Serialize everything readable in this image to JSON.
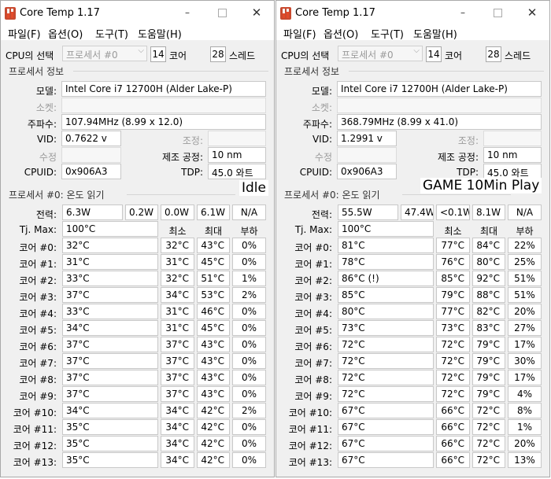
{
  "windows": [
    {
      "title": "Core Temp 1.17",
      "menu": [
        "파일(F)",
        "옵션(O)",
        "도구(T)",
        "도움말(H)"
      ],
      "cpu_select_label": "CPU의 선택",
      "processor_select": "프로세서 #0",
      "cores_count": "14",
      "cores_label": "코어",
      "threads_count": "28",
      "threads_label": "스레드",
      "info_group": "프로세서 정보",
      "model_label": "모델:",
      "model": "Intel Core i7 12700H (Alder Lake-P)",
      "socket_label": "소켓:",
      "frequency_label": "주파수:",
      "frequency": "107.94MHz (8.99 x 12.0)",
      "vid_label": "VID:",
      "vid": "0.7622 v",
      "modulation_label": "조정:",
      "revision_label": "수정",
      "lithography_label": "제조 공정:",
      "lithography": "10 nm",
      "cpuid_label": "CPUID:",
      "cpuid": "0x906A3",
      "tdp_label": "TDP:",
      "tdp": "45.0 와트",
      "temp_group": "프로세서 #0: 온도 읽기",
      "power_label": "전력:",
      "power_values": [
        "6.3W",
        "0.2W",
        "0.0W",
        "6.1W",
        "N/A"
      ],
      "tjmax_label": "Tj. Max:",
      "tjmax": "100°C",
      "min_header": "최소",
      "max_header": "최대",
      "load_header": "부하",
      "cores": [
        {
          "label": "코어 #0:",
          "temp": "32°C",
          "min": "32°C",
          "max": "43°C",
          "load": "0%"
        },
        {
          "label": "코어 #1:",
          "temp": "31°C",
          "min": "31°C",
          "max": "45°C",
          "load": "0%"
        },
        {
          "label": "코어 #2:",
          "temp": "33°C",
          "min": "32°C",
          "max": "51°C",
          "load": "1%"
        },
        {
          "label": "코어 #3:",
          "temp": "37°C",
          "min": "34°C",
          "max": "53°C",
          "load": "2%"
        },
        {
          "label": "코어 #4:",
          "temp": "33°C",
          "min": "31°C",
          "max": "46°C",
          "load": "0%"
        },
        {
          "label": "코어 #5:",
          "temp": "34°C",
          "min": "31°C",
          "max": "45°C",
          "load": "0%"
        },
        {
          "label": "코어 #6:",
          "temp": "37°C",
          "min": "37°C",
          "max": "43°C",
          "load": "0%"
        },
        {
          "label": "코어 #7:",
          "temp": "37°C",
          "min": "37°C",
          "max": "43°C",
          "load": "0%"
        },
        {
          "label": "코어 #8:",
          "temp": "37°C",
          "min": "37°C",
          "max": "43°C",
          "load": "0%"
        },
        {
          "label": "코어 #9:",
          "temp": "37°C",
          "min": "37°C",
          "max": "43°C",
          "load": "0%"
        },
        {
          "label": "코어 #10:",
          "temp": "34°C",
          "min": "34°C",
          "max": "42°C",
          "load": "2%"
        },
        {
          "label": "코어 #11:",
          "temp": "35°C",
          "min": "34°C",
          "max": "42°C",
          "load": "0%"
        },
        {
          "label": "코어 #12:",
          "temp": "35°C",
          "min": "34°C",
          "max": "42°C",
          "load": "0%"
        },
        {
          "label": "코어 #13:",
          "temp": "35°C",
          "min": "34°C",
          "max": "42°C",
          "load": "0%"
        }
      ]
    },
    {
      "title": "Core Temp 1.17",
      "menu": [
        "파일(F)",
        "옵션(O)",
        "도구(T)",
        "도움말(H)"
      ],
      "cpu_select_label": "CPU의 선택",
      "processor_select": "프로세서 #0",
      "cores_count": "14",
      "cores_label": "코어",
      "threads_count": "28",
      "threads_label": "스레드",
      "info_group": "프로세서 정보",
      "model_label": "모델:",
      "model": "Intel Core i7 12700H (Alder Lake-P)",
      "socket_label": "소켓:",
      "frequency_label": "주파수:",
      "frequency": "368.79MHz (8.99 x 41.0)",
      "vid_label": "VID:",
      "vid": "1.2991 v",
      "modulation_label": "조정:",
      "revision_label": "수정",
      "lithography_label": "제조 공정:",
      "lithography": "10 nm",
      "cpuid_label": "CPUID:",
      "cpuid": "0x906A3",
      "tdp_label": "TDP:",
      "tdp": "45.0 와트",
      "temp_group": "프로세서 #0: 온도 읽기",
      "power_label": "전력:",
      "power_values": [
        "55.5W",
        "47.4W",
        "<0.1W",
        "8.1W",
        "N/A"
      ],
      "tjmax_label": "Tj. Max:",
      "tjmax": "100°C",
      "min_header": "최소",
      "max_header": "최대",
      "load_header": "부하",
      "cores": [
        {
          "label": "코어 #0:",
          "temp": "81°C",
          "min": "77°C",
          "max": "84°C",
          "load": "22%"
        },
        {
          "label": "코어 #1:",
          "temp": "78°C",
          "min": "76°C",
          "max": "80°C",
          "load": "25%"
        },
        {
          "label": "코어 #2:",
          "temp": "86°C (!)",
          "min": "85°C",
          "max": "92°C",
          "load": "51%"
        },
        {
          "label": "코어 #3:",
          "temp": "85°C",
          "min": "79°C",
          "max": "88°C",
          "load": "51%"
        },
        {
          "label": "코어 #4:",
          "temp": "80°C",
          "min": "77°C",
          "max": "82°C",
          "load": "20%"
        },
        {
          "label": "코어 #5:",
          "temp": "73°C",
          "min": "73°C",
          "max": "83°C",
          "load": "27%"
        },
        {
          "label": "코어 #6:",
          "temp": "72°C",
          "min": "72°C",
          "max": "79°C",
          "load": "17%"
        },
        {
          "label": "코어 #7:",
          "temp": "72°C",
          "min": "72°C",
          "max": "79°C",
          "load": "30%"
        },
        {
          "label": "코어 #8:",
          "temp": "72°C",
          "min": "72°C",
          "max": "79°C",
          "load": "17%"
        },
        {
          "label": "코어 #9:",
          "temp": "72°C",
          "min": "72°C",
          "max": "79°C",
          "load": "4%"
        },
        {
          "label": "코어 #10:",
          "temp": "67°C",
          "min": "66°C",
          "max": "72°C",
          "load": "8%"
        },
        {
          "label": "코어 #11:",
          "temp": "67°C",
          "min": "66°C",
          "max": "72°C",
          "load": "1%"
        },
        {
          "label": "코어 #12:",
          "temp": "67°C",
          "min": "66°C",
          "max": "72°C",
          "load": "20%"
        },
        {
          "label": "코어 #13:",
          "temp": "67°C",
          "min": "66°C",
          "max": "72°C",
          "load": "13%"
        }
      ]
    }
  ],
  "labels": {
    "idle": "Idle",
    "game": "GAME 10Min Play"
  },
  "icons": {
    "app": "core-temp-app-icon",
    "minimize": "minimize-icon",
    "maximize": "maximize-icon",
    "close": "close-icon",
    "dropdown": "chevron-down-icon"
  }
}
